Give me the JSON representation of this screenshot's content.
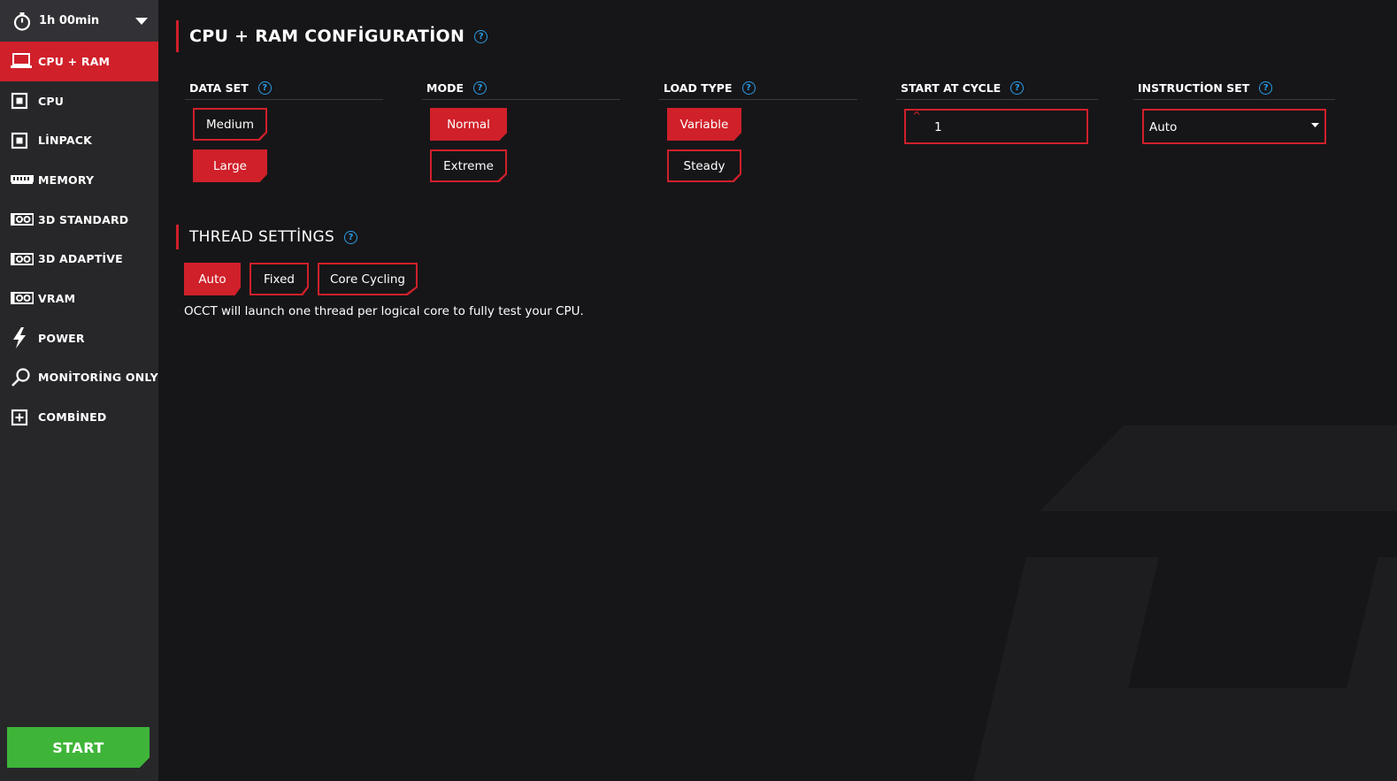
{
  "sidebar": {
    "duration": "1h 00min",
    "items": [
      {
        "label": "CPU + RAM",
        "icon": "laptop-icon",
        "active": true
      },
      {
        "label": "CPU",
        "icon": "chip-icon"
      },
      {
        "label": "LİNPACK",
        "icon": "chip-icon"
      },
      {
        "label": "MEMORY",
        "icon": "memory-icon"
      },
      {
        "label": "3D STANDARD",
        "icon": "gpu-icon"
      },
      {
        "label": "3D ADAPTİVE",
        "icon": "gpu-icon"
      },
      {
        "label": "VRAM",
        "icon": "gpu-icon"
      },
      {
        "label": "POWER",
        "icon": "lightning-icon"
      },
      {
        "label": "MONİTORİNG ONLY",
        "icon": "magnifier-icon"
      },
      {
        "label": "COMBİNED",
        "icon": "plus-box-icon"
      }
    ],
    "start_label": "START"
  },
  "main": {
    "title": "CPU + RAM CONFİGURATİON",
    "help_glyph": "?",
    "columns": {
      "data_set": {
        "header": "DATA SET",
        "options": [
          "Medium",
          "Large"
        ],
        "selected": "Large"
      },
      "mode": {
        "header": "MODE",
        "options": [
          "Normal",
          "Extreme"
        ],
        "selected": "Normal"
      },
      "load_type": {
        "header": "LOAD TYPE",
        "options": [
          "Variable",
          "Steady"
        ],
        "selected": "Variable"
      },
      "start_at_cycle": {
        "header": "START AT CYCLE",
        "value": "1",
        "spin_glyph": "^"
      },
      "instruction_set": {
        "header": "INSTRUCTİON SET",
        "value": "Auto"
      }
    },
    "thread": {
      "title": "THREAD SETTİNGS",
      "options": [
        "Auto",
        "Fixed",
        "Core Cycling"
      ],
      "selected": "Auto",
      "description": "OCCT will launch one thread per logical core to fully test your CPU."
    }
  },
  "colors": {
    "accent": "#d0202a",
    "start": "#3eb539",
    "help": "#2b9de8",
    "sidebar_bg": "#27272a",
    "main_bg": "#161618"
  }
}
